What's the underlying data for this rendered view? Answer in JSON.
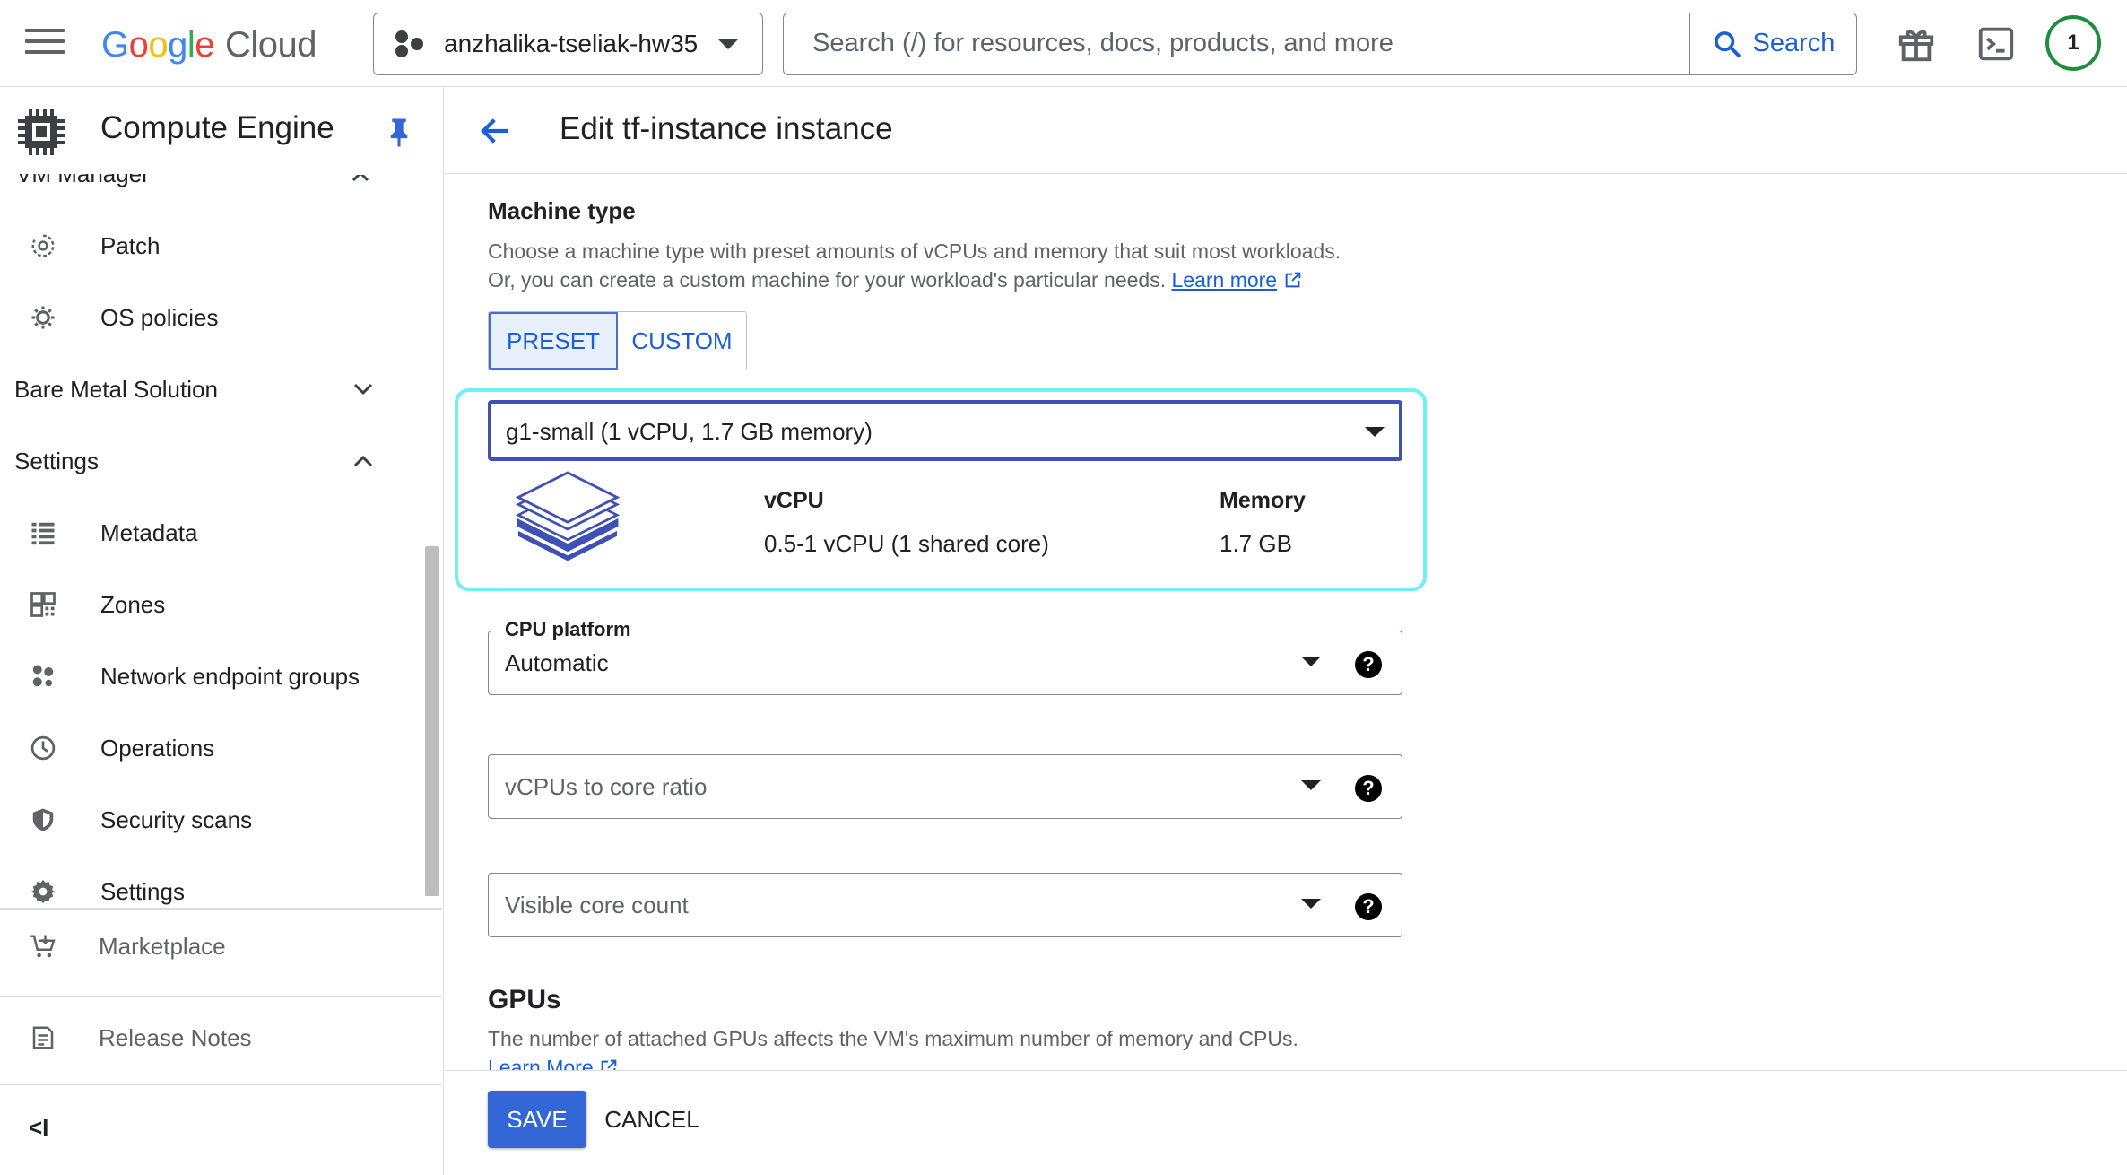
{
  "topbar": {
    "logo_google": [
      "G",
      "o",
      "o",
      "g",
      "l",
      "e"
    ],
    "logo_google_colors": [
      "#4285f4",
      "#ea4335",
      "#fbbc05",
      "#4285f4",
      "#34a853",
      "#ea4335"
    ],
    "logo_cloud": "Cloud",
    "project_name": "anzhalika-tseliak-hw35",
    "search_placeholder": "Search (/) for resources, docs, products, and more",
    "search_label": "Search",
    "avatar_label": "1"
  },
  "sidebar": {
    "product_title": "Compute Engine",
    "partial_item": "VM Manager",
    "items_top": [
      {
        "label": "Patch",
        "icon": "patch-icon"
      },
      {
        "label": "OS policies",
        "icon": "os-policies-icon"
      }
    ],
    "sections": [
      {
        "label": "Bare Metal Solution",
        "expanded": false
      },
      {
        "label": "Settings",
        "expanded": true
      }
    ],
    "items_settings": [
      {
        "label": "Metadata",
        "icon": "metadata-icon"
      },
      {
        "label": "Zones",
        "icon": "zones-icon"
      },
      {
        "label": "Network endpoint groups",
        "icon": "network-endpoint-groups-icon"
      },
      {
        "label": "Operations",
        "icon": "clock-icon"
      },
      {
        "label": "Security scans",
        "icon": "shield-icon"
      },
      {
        "label": "Settings",
        "icon": "gear-icon"
      }
    ],
    "marketplace": "Marketplace",
    "release_notes": "Release Notes",
    "collapse_glyph": "<I"
  },
  "main": {
    "page_title": "Edit tf-instance instance",
    "machine_type": {
      "heading": "Machine type",
      "desc_line1": "Choose a machine type with preset amounts of vCPUs and memory that suit most workloads.",
      "desc_line2": "Or, you can create a custom machine for your workload's particular needs.",
      "learn_more": "Learn more",
      "preset_label": "PRESET",
      "custom_label": "CUSTOM",
      "selected": "g1-small (1 vCPU, 1.7 GB memory)",
      "vcpu_head": "vCPU",
      "vcpu_value": "0.5-1 vCPU (1 shared core)",
      "memory_head": "Memory",
      "memory_value": "1.7 GB"
    },
    "cpu_platform": {
      "label": "CPU platform",
      "value": "Automatic"
    },
    "vcpu_ratio": {
      "placeholder": "vCPUs to core ratio"
    },
    "visible_cores": {
      "placeholder": "Visible core count"
    },
    "gpus": {
      "heading": "GPUs",
      "desc": "The number of attached GPUs affects the VM's maximum number of memory and CPUs.",
      "learn_more": "Learn More"
    },
    "save_label": "SAVE",
    "cancel_label": "CANCEL"
  },
  "colors": {
    "accent": "#1a5fd8",
    "primary_button": "#3367d6",
    "highlight": "#6ef0f5",
    "avatar_ring": "#1e8e3e"
  }
}
